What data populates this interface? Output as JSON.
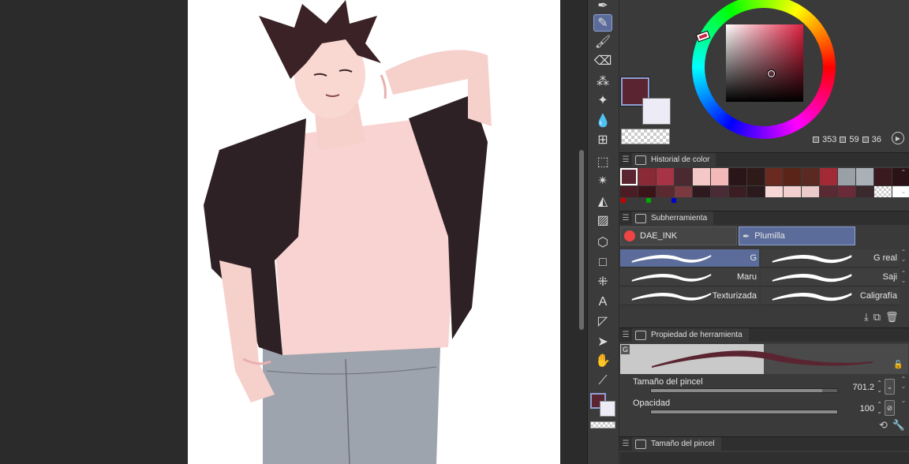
{
  "toolbar": {
    "tools": [
      {
        "name": "pen-tool-icon",
        "glyph": "✒"
      },
      {
        "name": "pencil-tool-icon",
        "glyph": "✎",
        "active": true
      },
      {
        "name": "brush-tool-icon",
        "glyph": "🖌"
      },
      {
        "name": "eraser-tool-icon",
        "glyph": "⌫"
      },
      {
        "name": "airbrush-tool-icon",
        "glyph": "⁂"
      },
      {
        "name": "decoration-tool-icon",
        "glyph": "✦"
      },
      {
        "name": "blend-tool-icon",
        "glyph": "💧"
      },
      {
        "name": "mesh-transform-icon",
        "glyph": "⊞"
      },
      {
        "name": "selection-tool-icon",
        "glyph": "⬚"
      },
      {
        "name": "auto-select-icon",
        "glyph": "✴"
      },
      {
        "name": "fill-tool-icon",
        "glyph": "◭"
      },
      {
        "name": "gradient-tool-icon",
        "glyph": "▨"
      },
      {
        "name": "object-tool-icon",
        "glyph": "⬡"
      },
      {
        "name": "figure-tool-icon",
        "glyph": "□"
      },
      {
        "name": "ruler-tool-icon",
        "glyph": "⁜"
      },
      {
        "name": "text-tool-icon",
        "glyph": "A"
      },
      {
        "name": "frame-border-icon",
        "glyph": "◸"
      },
      {
        "name": "operation-tool-icon",
        "glyph": "➤"
      },
      {
        "name": "hand-tool-icon",
        "glyph": "✋"
      },
      {
        "name": "eyedropper-tool-icon",
        "glyph": "⟋"
      }
    ]
  },
  "color_wheel": {
    "hsv": {
      "h": "353",
      "s": "59",
      "v": "36"
    },
    "main_color": "#5a2530",
    "sub_color": "#ecebf6"
  },
  "color_history": {
    "title": "Historial de color",
    "row1": [
      "#5a2530",
      "#8a2a36",
      "#a73444",
      "#4a2a30",
      "#f5c8c8",
      "#f3b9b9",
      "#2a1518",
      "#2f1a1a",
      "#6a2a20",
      "#5a2418",
      "#5a2a22",
      "#a22a36",
      "#9aa0a8",
      "#aab0b8",
      "#3a1a1e",
      "#2a1216"
    ],
    "row2": [
      "#4a1c24",
      "#3a1418",
      "#5a2a30",
      "#7a3a40",
      "#2e1a1e",
      "#4a2a34",
      "#3a1e24",
      "#2a1a1e",
      "#f8d6d6",
      "#f2d0d0",
      "#ebcaca",
      "#5a2a34",
      "#6a2a38",
      "#3a2a2e",
      "transparent",
      "#ffffff"
    ]
  },
  "subtool": {
    "title": "Subherramienta",
    "tabs": [
      "DAE_INK",
      "Plumilla"
    ],
    "brushes": [
      {
        "name": "G",
        "selected": true
      },
      {
        "name": "G real"
      },
      {
        "name": "Maru"
      },
      {
        "name": "Saji"
      },
      {
        "name": "Texturizada"
      },
      {
        "name": "Caligrafía"
      }
    ]
  },
  "tool_property": {
    "title": "Propiedad de herramienta",
    "brush_badge": "G",
    "brush_size": {
      "label": "Tamaño del pincel",
      "value": "701.2",
      "level": 0.92
    },
    "opacity": {
      "label": "Opacidad",
      "value": "100",
      "level": 1.0
    }
  },
  "brush_size_panel": {
    "title": "Tamaño del pincel"
  }
}
